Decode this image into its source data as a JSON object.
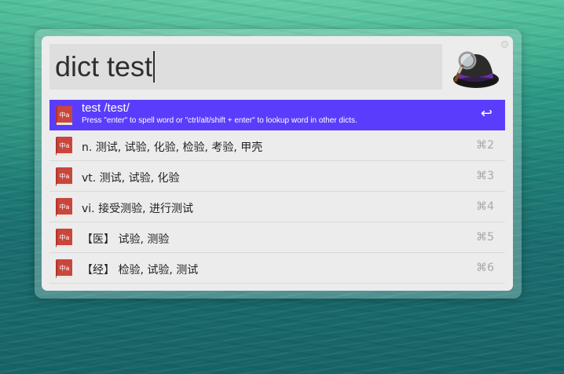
{
  "window": {
    "app": "Alfred"
  },
  "search": {
    "value": "dict test"
  },
  "results": [
    {
      "title": "test /test/",
      "subtitle": "Press \"enter\" to spell word or \"ctrl/alt/shift + enter\" to lookup word in other dicts.",
      "shortcut": "↩",
      "selected": true,
      "icon": "dictionary-book-icon"
    },
    {
      "title": "n. 测试, 试验, 化验, 检验, 考验, 甲壳",
      "shortcut": "⌘2",
      "selected": false,
      "icon": "dictionary-book-icon"
    },
    {
      "title": "vt. 测试, 试验, 化验",
      "shortcut": "⌘3",
      "selected": false,
      "icon": "dictionary-book-icon"
    },
    {
      "title": "vi. 接受测验, 进行测试",
      "shortcut": "⌘4",
      "selected": false,
      "icon": "dictionary-book-icon"
    },
    {
      "title": "【医】 试验, 测验",
      "shortcut": "⌘5",
      "selected": false,
      "icon": "dictionary-book-icon"
    },
    {
      "title": "【经】 检验, 试验, 测试",
      "shortcut": "⌘6",
      "selected": false,
      "icon": "dictionary-book-icon"
    }
  ],
  "book_icon_text": "中a",
  "colors": {
    "selection": "#5a3dfc",
    "window_bg": "#ececec",
    "search_bg": "#dedede",
    "book_red": "#b3322c"
  }
}
